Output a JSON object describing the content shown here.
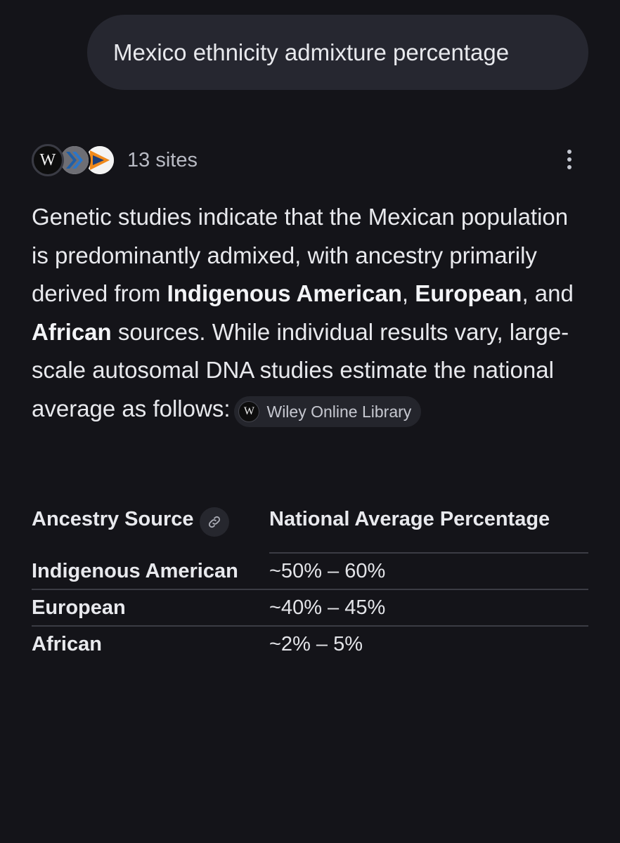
{
  "query": {
    "text": "Mexico ethnicity admixture percentage"
  },
  "sources": {
    "count_label": "13 sites",
    "favicons": [
      "wiley-w-icon",
      "chevron-arrows-icon",
      "play-arrow-icon"
    ]
  },
  "answer": {
    "p1": "Genetic studies indicate that the Mexican population is predominantly admixed, with ancestry primarily derived from ",
    "b1": "Indigenous American",
    "p2": ", ",
    "b2": "European",
    "p3": ", and ",
    "b3": "African",
    "p4": " sources. While individual results vary, large-scale autosomal DNA studies estimate the national average as follows:",
    "citation": {
      "icon_letter": "W",
      "label": "Wiley Online Library"
    }
  },
  "table": {
    "headers": [
      "Ancestry Source",
      "National Average Percentage"
    ],
    "rows": [
      {
        "source": "Indigenous American",
        "value": "~50% – 60%"
      },
      {
        "source": "European",
        "value": "~40% – 45%"
      },
      {
        "source": "African",
        "value": "~2% – 5%"
      }
    ]
  },
  "icons": {
    "wiley_letter": "W"
  },
  "colors": {
    "background": "#141419",
    "bubble": "#262730",
    "text": "#e8e9ed",
    "muted": "#b8bac3",
    "divider": "#3b3c44"
  }
}
